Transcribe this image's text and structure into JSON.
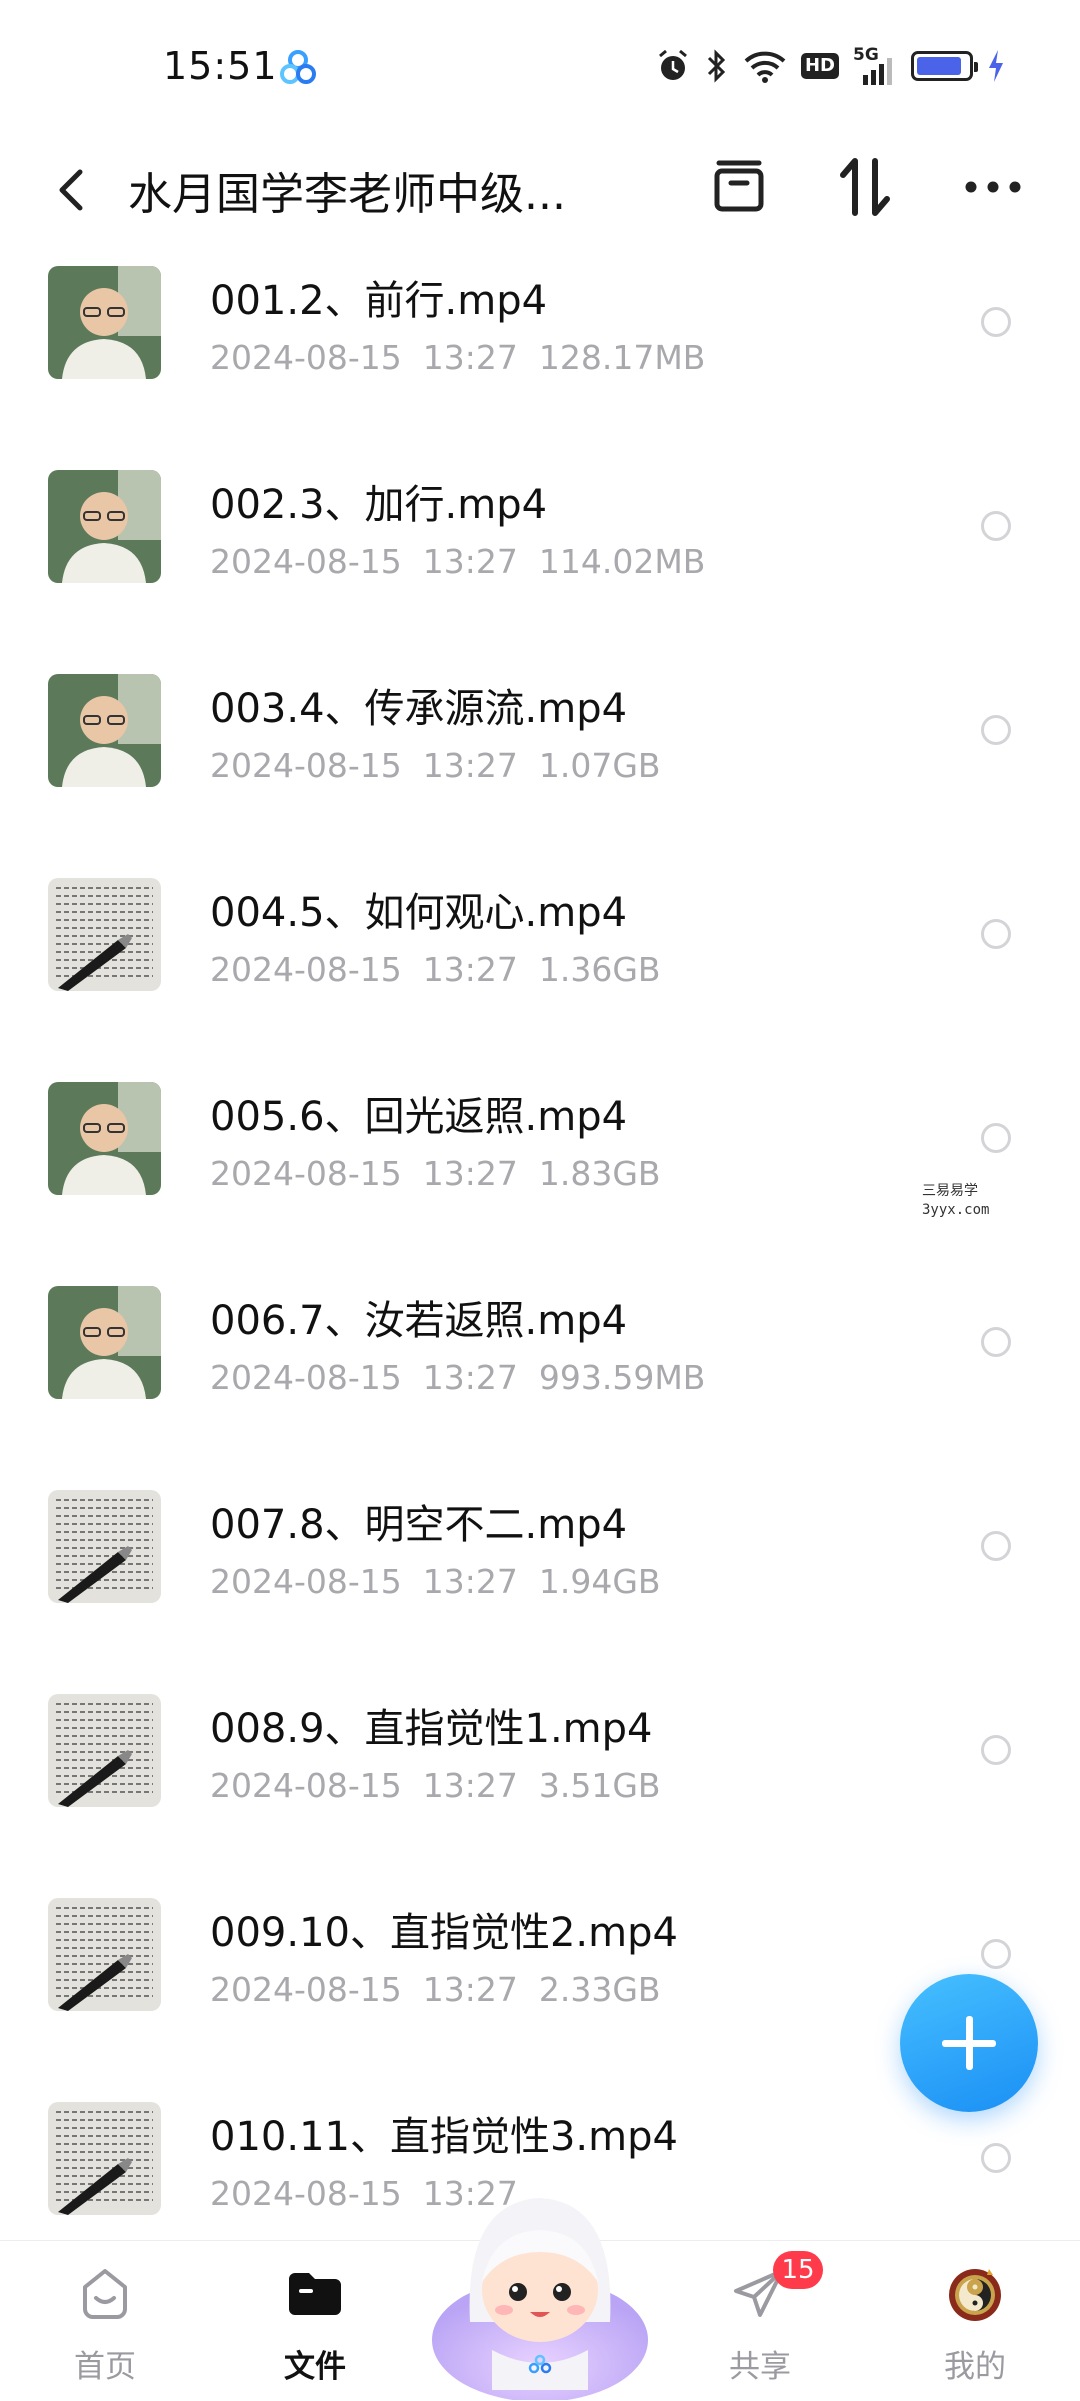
{
  "status_bar": {
    "time": "15:51",
    "network_label": "5G",
    "hd_label": "HD",
    "battery_level_fraction": 0.9,
    "icons": [
      "app-logo-icon",
      "alarm-icon",
      "bluetooth-icon",
      "wifi-icon",
      "hd-icon",
      "signal-icon",
      "battery-icon",
      "charging-icon"
    ]
  },
  "header": {
    "title": "水月国学李老师中级...",
    "icons": [
      "back-icon",
      "archive-icon",
      "sort-icon",
      "more-icon"
    ]
  },
  "files": [
    {
      "name": "001.2、前行.mp4",
      "date": "2024-08-15",
      "time": "13:27",
      "size": "128.17MB",
      "thumb": "person"
    },
    {
      "name": "002.3、加行.mp4",
      "date": "2024-08-15",
      "time": "13:27",
      "size": "114.02MB",
      "thumb": "person"
    },
    {
      "name": "003.4、传承源流.mp4",
      "date": "2024-08-15",
      "time": "13:27",
      "size": "1.07GB",
      "thumb": "person"
    },
    {
      "name": "004.5、如何观心.mp4",
      "date": "2024-08-15",
      "time": "13:27",
      "size": "1.36GB",
      "thumb": "book"
    },
    {
      "name": "005.6、回光返照.mp4",
      "date": "2024-08-15",
      "time": "13:27",
      "size": "1.83GB",
      "thumb": "person"
    },
    {
      "name": "006.7、汝若返照.mp4",
      "date": "2024-08-15",
      "time": "13:27",
      "size": "993.59MB",
      "thumb": "person"
    },
    {
      "name": "007.8、明空不二.mp4",
      "date": "2024-08-15",
      "time": "13:27",
      "size": "1.94GB",
      "thumb": "book"
    },
    {
      "name": "008.9、直指觉性1.mp4",
      "date": "2024-08-15",
      "time": "13:27",
      "size": "3.51GB",
      "thumb": "book"
    },
    {
      "name": "009.10、直指觉性2.mp4",
      "date": "2024-08-15",
      "time": "13:27",
      "size": "2.33GB",
      "thumb": "book"
    },
    {
      "name": "010.11、直指觉性3.mp4",
      "date": "2024-08-15",
      "time": "13:27",
      "size": "",
      "thumb": "book"
    }
  ],
  "watermark": {
    "line1": "三易易学",
    "line2": "3yyx.com"
  },
  "nav": {
    "home": "首页",
    "files": "文件",
    "share": "共享",
    "share_badge": "15",
    "mine": "我的"
  },
  "colors": {
    "accent": "#1a8ff5",
    "meta_text": "#a8a8ad",
    "badge": "#ff3b4b",
    "battery_fill": "#4b63e8"
  }
}
